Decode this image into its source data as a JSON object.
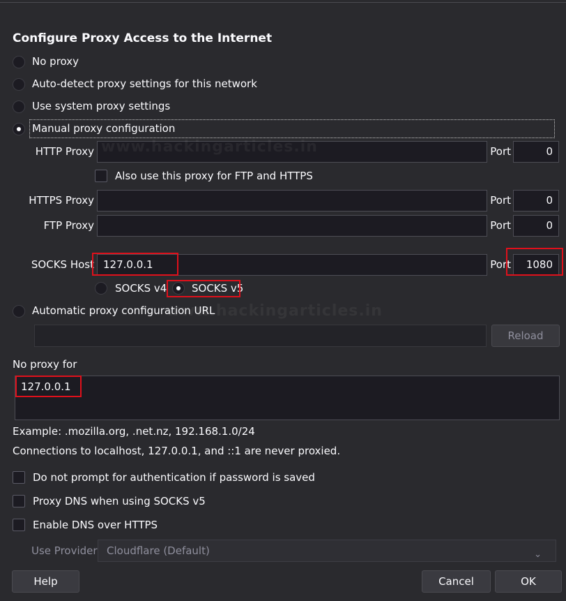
{
  "dialog": {
    "title": "Configure Proxy Access to the Internet",
    "watermark": "www.hackingarticles.in"
  },
  "proxy_options": [
    {
      "label": "No proxy",
      "selected": false
    },
    {
      "label": "Auto-detect proxy settings for this network",
      "selected": false
    },
    {
      "label": "Use system proxy settings",
      "selected": false
    },
    {
      "label": "Manual proxy configuration",
      "selected": true
    }
  ],
  "manual": {
    "http_label": "HTTP Proxy",
    "http_value": "",
    "http_port": "0",
    "also_use_label": "Also use this proxy for FTP and HTTPS",
    "https_label": "HTTPS Proxy",
    "https_value": "",
    "https_port": "0",
    "ftp_label": "FTP Proxy",
    "ftp_value": "",
    "ftp_port": "0",
    "socks_label": "SOCKS Host",
    "socks_value": "127.0.0.1",
    "socks_port": "1080",
    "port_label": "Port",
    "socks_v4_label": "SOCKS v4",
    "socks_v5_label": "SOCKS v5",
    "socks_version_selected": "v5"
  },
  "auto_config": {
    "label": "Automatic proxy configuration URL",
    "url_value": "",
    "reload_label": "Reload"
  },
  "no_proxy": {
    "label": "No proxy for",
    "value": "127.0.0.1",
    "example": "Example: .mozilla.org, .net.nz, 192.168.1.0/24",
    "localhost_note": "Connections to localhost, 127.0.0.1, and ::1 are never proxied."
  },
  "checkboxes": [
    {
      "label": "Do not prompt for authentication if password is saved",
      "checked": false
    },
    {
      "label": "Proxy DNS when using SOCKS v5",
      "checked": false
    },
    {
      "label": "Enable DNS over HTTPS",
      "checked": false
    }
  ],
  "provider": {
    "label": "Use Provider",
    "selected": "Cloudflare (Default)"
  },
  "buttons": {
    "help": "Help",
    "cancel": "Cancel",
    "ok": "OK"
  }
}
